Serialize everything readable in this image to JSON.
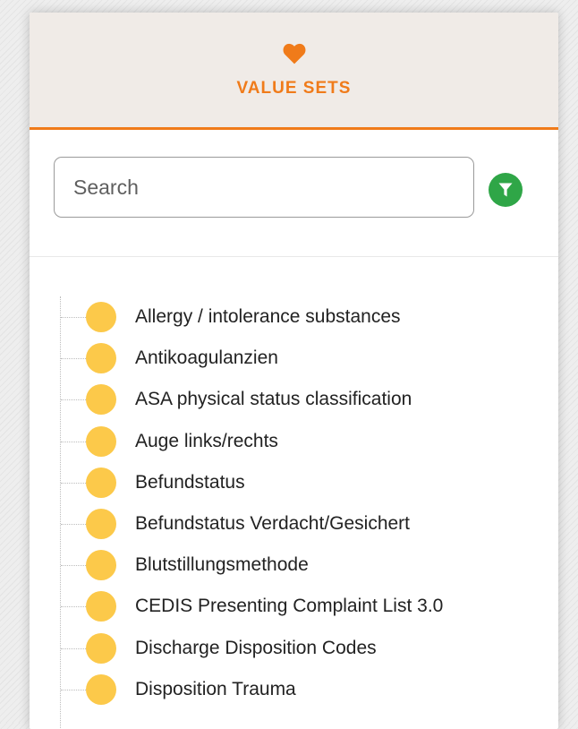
{
  "header": {
    "title": "VALUE SETS",
    "icon": "heart-icon",
    "accent_color": "#f07b1a"
  },
  "search": {
    "placeholder": "Search",
    "value": "",
    "filter_icon": "filter-icon",
    "filter_color": "#2fa647"
  },
  "tree": {
    "node_color": "#fcc94a",
    "items": [
      {
        "label": "Allergy / intolerance substances"
      },
      {
        "label": "Antikoagulanzien"
      },
      {
        "label": "ASA physical status classification"
      },
      {
        "label": "Auge links/rechts"
      },
      {
        "label": "Befundstatus"
      },
      {
        "label": "Befundstatus Verdacht/Gesichert"
      },
      {
        "label": "Blutstillungsmethode"
      },
      {
        "label": "CEDIS Presenting Complaint List 3.0"
      },
      {
        "label": "Discharge Disposition Codes"
      },
      {
        "label": "Disposition Trauma"
      }
    ]
  }
}
